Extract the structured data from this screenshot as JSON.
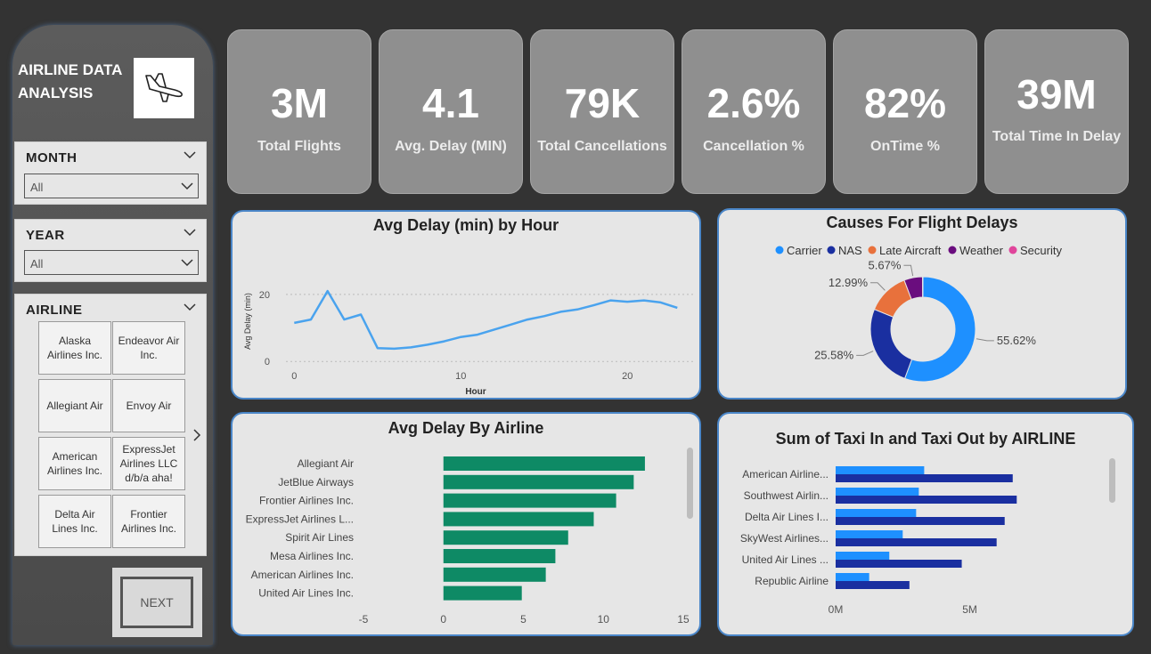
{
  "sidebar": {
    "title": "AIRLINE DATA ANALYSIS",
    "logo_icon": "airplane-landing-icon",
    "month": {
      "title": "MONTH",
      "value": "All"
    },
    "year": {
      "title": "YEAR",
      "value": "All"
    },
    "airline": {
      "title": "AIRLINE",
      "tiles": [
        "Alaska Airlines Inc.",
        "Endeavor Air Inc.",
        "Allegiant Air",
        "Envoy Air",
        "American Airlines Inc.",
        "ExpressJet Airlines LLC d/b/a aha!",
        "Delta Air Lines Inc.",
        "Frontier Airlines Inc."
      ]
    },
    "next_label": "NEXT"
  },
  "kpis": [
    {
      "value": "3M",
      "label": "Total Flights"
    },
    {
      "value": "4.1",
      "label": "Avg. Delay (MIN)"
    },
    {
      "value": "79K",
      "label": "Total Cancellations"
    },
    {
      "value": "2.6%",
      "label": "Cancellation %"
    },
    {
      "value": "82%",
      "label": "OnTime %"
    },
    {
      "value": "39M",
      "label": "Total Time In Delay"
    }
  ],
  "colors": {
    "background": "#333333",
    "panel": "#e6e6e6",
    "panel_border": "#4a86c8",
    "kpi": "#8f8f8f",
    "line": "#4aa3ee",
    "bar_green": "#0e8a65",
    "taxi_in": "#1e90ff",
    "taxi_out": "#1a2fa0",
    "carrier": "#1e90ff",
    "nas": "#1a2fa0",
    "late_aircraft": "#e8713c",
    "weather": "#6a0d7e",
    "security": "#e0459b"
  },
  "chart_data": [
    {
      "type": "line",
      "title": "Avg Delay (min) by Hour",
      "xlabel": "Hour",
      "ylabel": "Avg Delay (min)",
      "x": [
        0,
        1,
        2,
        3,
        4,
        5,
        6,
        7,
        8,
        9,
        10,
        11,
        12,
        13,
        14,
        15,
        16,
        17,
        18,
        19,
        20,
        21,
        22,
        23
      ],
      "values": [
        11.5,
        12.5,
        21,
        12.5,
        14,
        4,
        3.8,
        4.2,
        5,
        6,
        7.3,
        8,
        9.5,
        11,
        12.5,
        13.5,
        14.8,
        15.5,
        16.8,
        18.2,
        17.8,
        18.2,
        17.6,
        16
      ],
      "xticks": [
        "0",
        "10",
        "20"
      ],
      "yticks": [
        "0",
        "20"
      ],
      "xlim": [
        -0.5,
        24
      ],
      "ylim": [
        -1,
        25
      ],
      "grid": true
    },
    {
      "type": "pie",
      "title": "Causes For Flight Delays",
      "legend": [
        "Carrier",
        "NAS",
        "Late Aircraft",
        "Weather",
        "Security"
      ],
      "slices": [
        {
          "name": "Carrier",
          "value": 55.62,
          "label": "55.62%"
        },
        {
          "name": "NAS",
          "value": 25.58,
          "label": "25.58%"
        },
        {
          "name": "Late Aircraft",
          "value": 12.99,
          "label": "12.99%"
        },
        {
          "name": "Weather",
          "value": 5.67,
          "label": "5.67%"
        },
        {
          "name": "Security",
          "value": 0.14,
          "label": ""
        }
      ]
    },
    {
      "type": "bar",
      "title": "Avg Delay By Airline",
      "categories": [
        "Allegiant Air",
        "JetBlue Airways",
        "Frontier Airlines Inc.",
        "ExpressJet Airlines L...",
        "Spirit Air Lines",
        "Mesa Airlines Inc.",
        "American Airlines Inc.",
        "United Air Lines Inc."
      ],
      "values": [
        12.6,
        11.9,
        10.8,
        9.4,
        7.8,
        7.0,
        6.4,
        4.9
      ],
      "xticks": [
        "-5",
        "0",
        "5",
        "10",
        "15"
      ],
      "xlim": [
        -5,
        15
      ]
    },
    {
      "type": "bar",
      "title": "Sum of Taxi In and Taxi Out by AIRLINE",
      "categories": [
        "American Airline...",
        "Southwest Airlin...",
        "Delta Air Lines I...",
        "SkyWest Airlines...",
        "United Air Lines ...",
        "Republic Airline"
      ],
      "series": [
        {
          "values": [
            3.3,
            3.1,
            3.0,
            2.5,
            2.0,
            1.25
          ]
        },
        {
          "values": [
            6.6,
            6.75,
            6.3,
            6.0,
            4.7,
            2.75
          ]
        }
      ],
      "units": "M",
      "xticks": [
        "0M",
        "5M"
      ],
      "xlim": [
        0,
        8.5
      ]
    }
  ]
}
